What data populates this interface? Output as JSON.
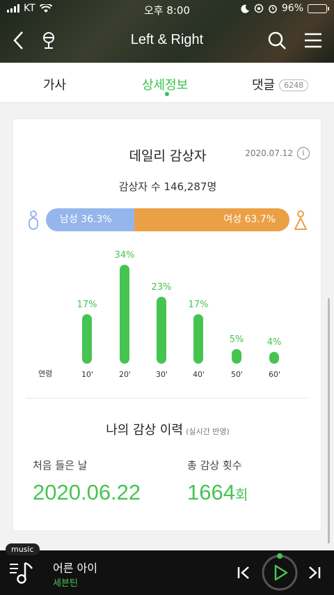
{
  "status": {
    "carrier": "KT",
    "time": "오후 8:00",
    "battery": "96%",
    "battery_level": 0.96
  },
  "header": {
    "title": "Left & Right"
  },
  "tabs": [
    {
      "label": "가사"
    },
    {
      "label": "상세정보"
    },
    {
      "label": "댓글",
      "count": "6248"
    }
  ],
  "daily": {
    "title": "데일리 감상자",
    "date": "2020.07.12",
    "info": "i",
    "listeners": "감상자 수 146,287명",
    "male": {
      "label": "남성 36.3%",
      "pct": 36.3
    },
    "female": {
      "label": "여성 63.7%",
      "pct": 63.7
    },
    "age_axis_label": "연령"
  },
  "chart_data": {
    "type": "bar",
    "categories": [
      "10'",
      "20'",
      "30'",
      "40'",
      "50'",
      "60'"
    ],
    "values": [
      17,
      34,
      23,
      17,
      5,
      4
    ],
    "labels": [
      "17%",
      "34%",
      "23%",
      "17%",
      "5%",
      "4%"
    ]
  },
  "history": {
    "title": "나의 감상 이력",
    "note": "(실시간 반영)",
    "first_label": "처음 들은 날",
    "first_value": "2020.06.22",
    "count_label": "총 감상 횟수",
    "count_value": "1664",
    "count_unit": "회"
  },
  "player": {
    "tag": "music",
    "song": "어른 아이",
    "artist": "세븐틴"
  },
  "colors": {
    "accent": "#46c452",
    "male": "#95b6ec",
    "female": "#eba045"
  }
}
